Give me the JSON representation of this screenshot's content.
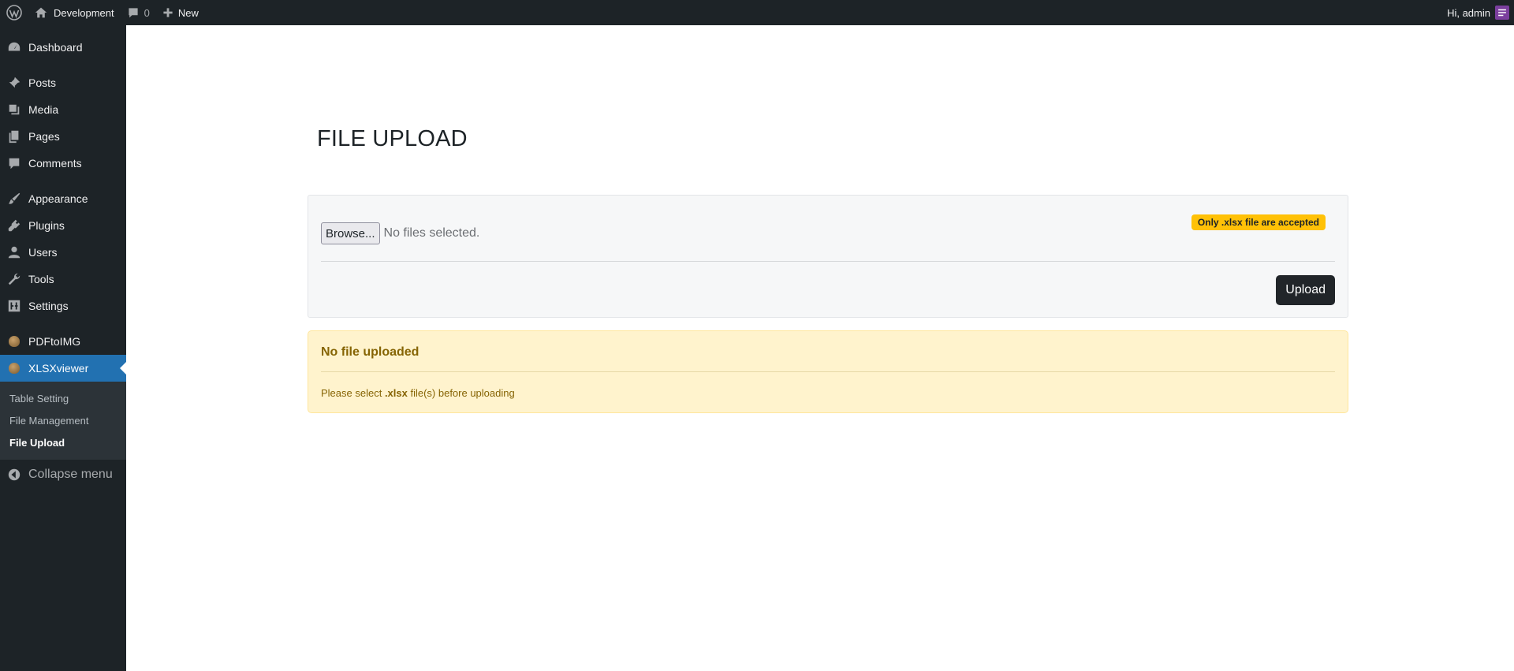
{
  "adminbar": {
    "site_name": "Development",
    "comments_count": "0",
    "new_label": "New",
    "greeting": "Hi, admin"
  },
  "sidebar": {
    "items": [
      {
        "label": "Dashboard",
        "icon": "dashboard-icon"
      },
      {
        "label": "Posts",
        "icon": "pin-icon"
      },
      {
        "label": "Media",
        "icon": "media-icon"
      },
      {
        "label": "Pages",
        "icon": "pages-icon"
      },
      {
        "label": "Comments",
        "icon": "comment-icon"
      },
      {
        "label": "Appearance",
        "icon": "brush-icon"
      },
      {
        "label": "Plugins",
        "icon": "plugin-icon"
      },
      {
        "label": "Users",
        "icon": "user-icon"
      },
      {
        "label": "Tools",
        "icon": "wrench-icon"
      },
      {
        "label": "Settings",
        "icon": "settings-icon"
      },
      {
        "label": "PDFtoIMG",
        "icon": "acorn-icon"
      },
      {
        "label": "XLSXviewer",
        "icon": "acorn-icon"
      }
    ],
    "submenu": [
      "Table Setting",
      "File Management",
      "File Upload"
    ],
    "collapse_label": "Collapse menu"
  },
  "main": {
    "title": "FILE UPLOAD",
    "upload": {
      "browse_label": "Browse...",
      "file_status": "No files selected.",
      "badge": "Only .xlsx file are accepted",
      "upload_label": "Upload"
    },
    "alert": {
      "heading": "No file uploaded",
      "text_before": "Please select ",
      "text_bold": ".xlsx",
      "text_after": " file(s) before uploading"
    }
  },
  "colors": {
    "adminbar_bg": "#1d2327",
    "accent": "#2271b1",
    "badge": "#ffc107",
    "alert_bg": "#fff3cd",
    "upload_button": "#212529"
  }
}
